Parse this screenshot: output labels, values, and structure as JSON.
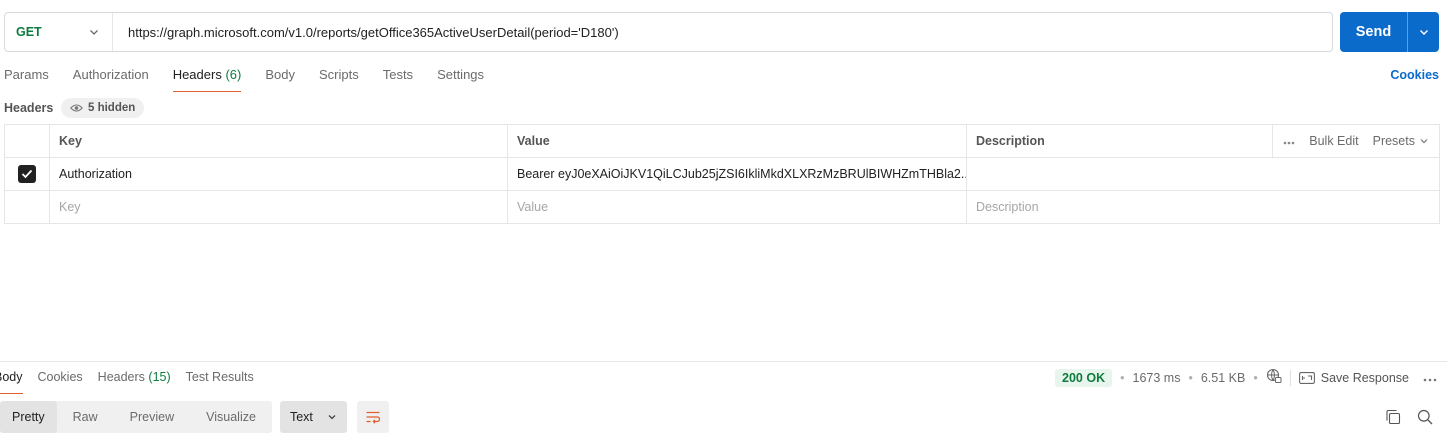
{
  "request": {
    "method": "GET",
    "url": "https://graph.microsoft.com/v1.0/reports/getOffice365ActiveUserDetail(period='D180')",
    "send_label": "Send"
  },
  "request_tabs": {
    "params": "Params",
    "authorization": "Authorization",
    "headers": "Headers",
    "headers_count": "(6)",
    "body": "Body",
    "scripts": "Scripts",
    "tests": "Tests",
    "settings": "Settings",
    "cookies": "Cookies"
  },
  "headers_section": {
    "label": "Headers",
    "hidden_badge": "5 hidden",
    "columns": {
      "key": "Key",
      "value": "Value",
      "description": "Description"
    },
    "bulk_edit": "Bulk Edit",
    "presets": "Presets",
    "rows": [
      {
        "checked": true,
        "key": "Authorization",
        "value": "Bearer eyJ0eXAiOiJKV1QiLCJub25jZSI6IkliMkdXLXRzMzBRUlBIWHZmTHBla2...",
        "description": ""
      }
    ],
    "placeholder": {
      "key": "Key",
      "value": "Value",
      "description": "Description"
    }
  },
  "response": {
    "tabs": {
      "body": "Body",
      "cookies": "Cookies",
      "headers": "Headers",
      "headers_count": "(15)",
      "test_results": "Test Results"
    },
    "status": "200 OK",
    "time": "1673 ms",
    "size": "6.51 KB",
    "save_response": "Save Response",
    "view_modes": [
      "Pretty",
      "Raw",
      "Preview",
      "Visualize"
    ],
    "format": "Text"
  },
  "colors": {
    "accent": "#0b6bcb",
    "method_green": "#0f7b3f",
    "tab_underline": "#e0612f"
  }
}
